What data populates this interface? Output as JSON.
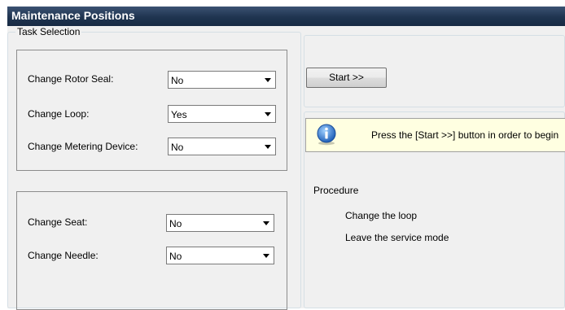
{
  "window": {
    "title": "Maintenance Positions"
  },
  "task_selection": {
    "legend": "Task Selection",
    "group1": [
      {
        "label": "Change Rotor Seal:",
        "value": "No"
      },
      {
        "label": "Change Loop:",
        "value": "Yes"
      },
      {
        "label": "Change Metering Device:",
        "value": "No"
      }
    ],
    "group2": [
      {
        "label": "Change Seat:",
        "value": "No"
      },
      {
        "label": "Change Needle:",
        "value": "No"
      }
    ]
  },
  "actions": {
    "start_label": "Start >>"
  },
  "info": {
    "icon": "info-icon",
    "message": "Press the [Start >>] button in order to begin"
  },
  "procedure": {
    "legend": "Procedure",
    "steps": [
      "Change the loop",
      "Leave the service mode"
    ]
  },
  "colors": {
    "titlebar": "#1f3450",
    "background": "#f0f0f0",
    "info_background": "#ffffe1",
    "info_icon": "#2f73c8"
  }
}
